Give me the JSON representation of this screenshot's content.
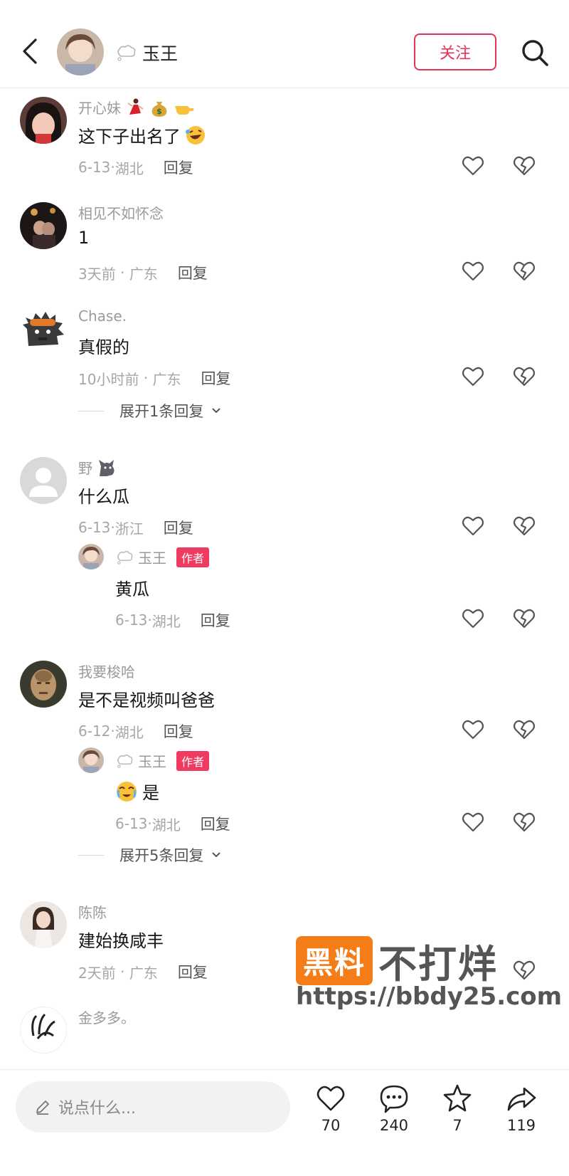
{
  "header": {
    "username": "玉王",
    "follow_label": "关注"
  },
  "comments": [
    {
      "username": "开心妹",
      "text": "这下子出名了",
      "date": "6-13",
      "location": "湖北",
      "reply_label": "回复"
    },
    {
      "username": "相见不如怀念",
      "text": "1",
      "date": "3天前",
      "location": "广东",
      "reply_label": "回复"
    },
    {
      "username": "Chase.",
      "text": "真假的",
      "date": "10小时前",
      "location": "广东",
      "reply_label": "回复",
      "expand_label": "展开1条回复"
    },
    {
      "username": "野",
      "text": "什么瓜",
      "date": "6-13",
      "location": "浙江",
      "reply_label": "回复",
      "reply": {
        "username": "玉王",
        "badge": "作者",
        "text": "黄瓜",
        "date": "6-13",
        "location": "湖北",
        "reply_label": "回复"
      }
    },
    {
      "username": "我要梭哈",
      "text": "是不是视频叫爸爸",
      "date": "6-12",
      "location": "湖北",
      "reply_label": "回复",
      "reply": {
        "username": "玉王",
        "badge": "作者",
        "text": "是",
        "date": "6-13",
        "location": "湖北",
        "reply_label": "回复"
      },
      "expand_label": "展开5条回复"
    },
    {
      "username": "陈陈",
      "text": "建始换咸丰",
      "date": "2天前",
      "location": "广东",
      "reply_label": "回复"
    },
    {
      "username": "金多多。"
    }
  ],
  "watermark": {
    "brand_box": "黑料",
    "brand_rest": "不打烊",
    "url": "https://bbdy25.com"
  },
  "bottom_bar": {
    "input_placeholder": "说点什么...",
    "likes": "70",
    "comments": "240",
    "favorites": "7",
    "shares": "119"
  },
  "colors": {
    "accent": "#e8315a",
    "watermark_orange": "#f47d17"
  }
}
